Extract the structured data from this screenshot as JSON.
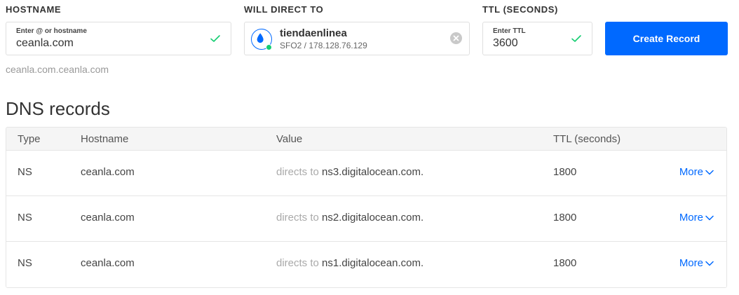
{
  "form": {
    "hostname": {
      "section_label": "HOSTNAME",
      "field_label": "Enter @ or hostname",
      "value": "ceanla.com",
      "preview": "ceanla.com.ceanla.com"
    },
    "direct_to": {
      "section_label": "WILL DIRECT TO",
      "droplet_name": "tiendaenlinea",
      "droplet_meta": "SFO2 / 178.128.76.129"
    },
    "ttl": {
      "section_label": "TTL (SECONDS)",
      "field_label": "Enter TTL",
      "value": "3600"
    },
    "create_button": "Create Record"
  },
  "dns": {
    "heading": "DNS records",
    "columns": {
      "type": "Type",
      "hostname": "Hostname",
      "value": "Value",
      "ttl": "TTL (seconds)"
    },
    "directs_prefix": "directs to",
    "more_label": "More",
    "records": [
      {
        "type": "NS",
        "hostname": "ceanla.com",
        "value": "ns3.digitalocean.com.",
        "ttl": "1800"
      },
      {
        "type": "NS",
        "hostname": "ceanla.com",
        "value": "ns2.digitalocean.com.",
        "ttl": "1800"
      },
      {
        "type": "NS",
        "hostname": "ceanla.com",
        "value": "ns1.digitalocean.com.",
        "ttl": "1800"
      }
    ]
  },
  "colors": {
    "accent": "#0069ff",
    "success": "#15cd72",
    "muted": "#999999"
  },
  "icons": {
    "valid": "check-icon",
    "droplet": "droplet-icon",
    "clear": "clear-icon",
    "expand": "chevron-down-icon"
  }
}
